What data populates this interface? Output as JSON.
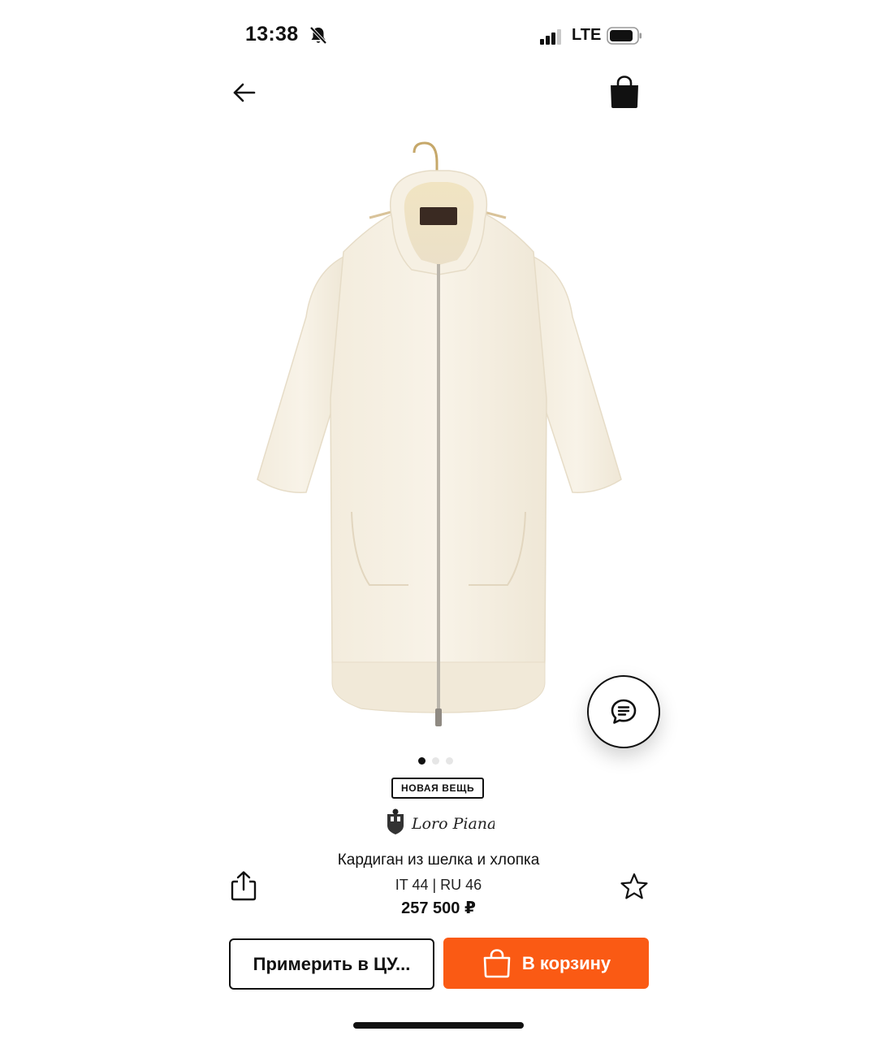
{
  "status_bar": {
    "time": "13:38",
    "carrier": "LTE",
    "mute_icon": "bell-slash-icon",
    "signal_icon": "signal-bars-icon",
    "battery_icon": "battery-icon"
  },
  "nav": {
    "back_icon": "arrow-left-icon",
    "bag_icon": "shopping-bag-icon"
  },
  "gallery": {
    "image_subject": "cardigan-photo",
    "page_count": 3,
    "current_page": 1
  },
  "product": {
    "badge": "НОВАЯ ВЕЩЬ",
    "brand": "Loro Piana",
    "title": "Кардиган из шелка и хлопка",
    "size": "IT 44 | RU 46",
    "price": "257 500 ₽"
  },
  "actions": {
    "try_on_label": "Примерить в ЦУ...",
    "add_to_cart_label": "В корзину",
    "share_icon": "share-icon",
    "favorite_icon": "star-icon",
    "chat_icon": "chat-icon"
  },
  "colors": {
    "accent": "#fa5a14",
    "text": "#111111",
    "garment": "#f5efe2"
  }
}
